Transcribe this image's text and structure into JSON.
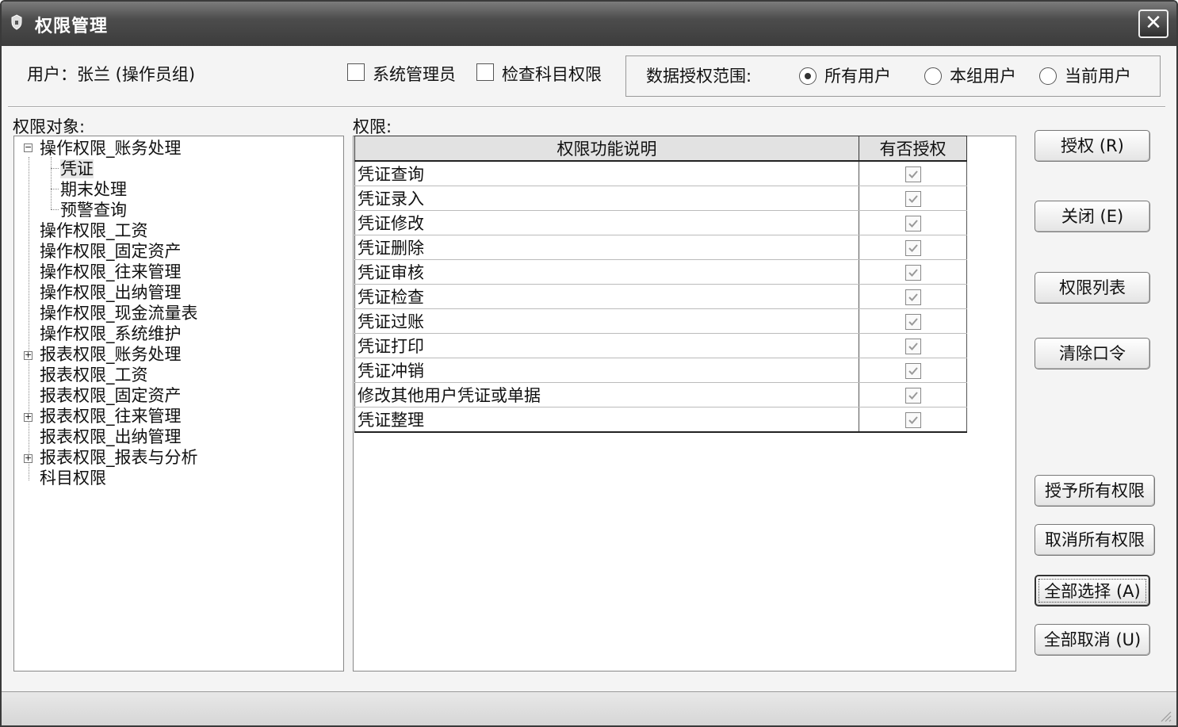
{
  "window": {
    "title": "权限管理",
    "close_glyph": "✕"
  },
  "header": {
    "user_label": "用户：张兰 (操作员组)",
    "sysadmin_label": "系统管理员",
    "sysadmin_checked": false,
    "subject_check_label": "检查科目权限",
    "subject_check_checked": false,
    "scope_label": "数据授权范围:",
    "scope_options": [
      {
        "label": "所有用户",
        "checked": true
      },
      {
        "label": "本组用户",
        "checked": false
      },
      {
        "label": "当前用户",
        "checked": false
      }
    ]
  },
  "tree": {
    "label": "权限对象:",
    "items": [
      {
        "label": "操作权限_账务处理",
        "expander": "⊟"
      },
      {
        "label": "凭证",
        "selected": true
      },
      {
        "label": "期末处理"
      },
      {
        "label": "预警查询"
      },
      {
        "label": "操作权限_工资"
      },
      {
        "label": "操作权限_固定资产"
      },
      {
        "label": "操作权限_往来管理"
      },
      {
        "label": "操作权限_出纳管理"
      },
      {
        "label": "操作权限_现金流量表"
      },
      {
        "label": "操作权限_系统维护"
      },
      {
        "label": "报表权限_账务处理",
        "expander": "⊞"
      },
      {
        "label": "报表权限_工资"
      },
      {
        "label": "报表权限_固定资产"
      },
      {
        "label": "报表权限_往来管理",
        "expander": "⊞"
      },
      {
        "label": "报表权限_出纳管理"
      },
      {
        "label": "报表权限_报表与分析",
        "expander": "⊞"
      },
      {
        "label": "科目权限"
      }
    ]
  },
  "grid": {
    "label": "权限:",
    "columns": [
      "权限功能说明",
      "有否授权"
    ],
    "rows": [
      {
        "name": "凭证查询",
        "granted": true
      },
      {
        "name": "凭证录入",
        "granted": true
      },
      {
        "name": "凭证修改",
        "granted": true
      },
      {
        "name": "凭证删除",
        "granted": true
      },
      {
        "name": "凭证审核",
        "granted": true
      },
      {
        "name": "凭证检查",
        "granted": true
      },
      {
        "name": "凭证过账",
        "granted": true
      },
      {
        "name": "凭证打印",
        "granted": true
      },
      {
        "name": "凭证冲销",
        "granted": true
      },
      {
        "name": "修改其他用户凭证或单据",
        "granted": true
      },
      {
        "name": "凭证整理",
        "granted": true
      }
    ]
  },
  "buttons": {
    "grant": "授权 (R)",
    "close": "关闭 (E)",
    "perm_list": "权限列表",
    "clear_password": "清除口令",
    "grant_all": "授予所有权限",
    "revoke_all": "取消所有权限",
    "select_all": "全部选择 (A)",
    "deselect_all": "全部取消 (U)"
  }
}
